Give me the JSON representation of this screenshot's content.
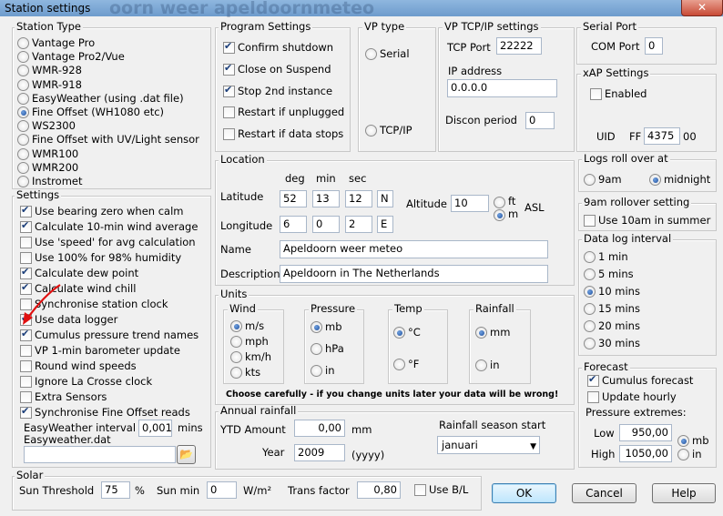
{
  "window": {
    "title": "Station settings",
    "ghost_text": "oorn weer apeldoornmeteo"
  },
  "station_type": {
    "title": "Station Type",
    "options": [
      "Vantage Pro",
      "Vantage Pro2/Vue",
      "WMR-928",
      "WMR-918",
      "EasyWeather (using .dat file)",
      "Fine Offset (WH1080 etc)",
      "WS2300",
      "Fine Offset with UV/Light sensor",
      "WMR100",
      "WMR200",
      "Instromet"
    ],
    "selected": "Fine Offset (WH1080 etc)"
  },
  "settings": {
    "title": "Settings",
    "items": [
      {
        "label": "Use bearing zero when calm",
        "checked": true
      },
      {
        "label": "Calculate 10-min wind average",
        "checked": true
      },
      {
        "label": "Use 'speed' for avg calculation",
        "checked": false
      },
      {
        "label": "Use 100% for 98% humidity",
        "checked": false
      },
      {
        "label": "Calculate dew point",
        "checked": true
      },
      {
        "label": "Calculate wind chill",
        "checked": true
      },
      {
        "label": "Synchronise station clock",
        "checked": false
      },
      {
        "label": "Use data logger",
        "checked": true
      },
      {
        "label": "Cumulus pressure trend names",
        "checked": true
      },
      {
        "label": "VP 1-min barometer update",
        "checked": false
      },
      {
        "label": "Round wind speeds",
        "checked": false
      },
      {
        "label": "Ignore La Crosse clock",
        "checked": false
      },
      {
        "label": "Extra Sensors",
        "checked": false
      },
      {
        "label": "Synchronise Fine Offset reads",
        "checked": true
      }
    ],
    "easyweather_interval_label": "EasyWeather interval",
    "easyweather_interval_value": "0,001",
    "easyweather_interval_unit": "mins",
    "easyweather_file_label": "Easyweather.dat",
    "easyweather_file_value": ""
  },
  "program": {
    "title": "Program Settings",
    "items": [
      {
        "label": "Confirm shutdown",
        "checked": true
      },
      {
        "label": "Close on Suspend",
        "checked": true
      },
      {
        "label": "Stop 2nd instance",
        "checked": true
      },
      {
        "label": "Restart if unplugged",
        "checked": false
      },
      {
        "label": "Restart if data stops",
        "checked": false
      }
    ]
  },
  "vp_type": {
    "title": "VP type",
    "serial": "Serial",
    "tcpip": "TCP/IP"
  },
  "vp_tcpip": {
    "title": "VP TCP/IP settings",
    "tcp_port_label": "TCP Port",
    "tcp_port": "22222",
    "ip_label": "IP address",
    "ip": "0.0.0.0",
    "discon_label": "Discon period",
    "discon": "0"
  },
  "serial_port": {
    "title": "Serial Port",
    "com_label": "COM Port",
    "com": "0"
  },
  "xap": {
    "title": "xAP Settings",
    "enabled_label": "Enabled",
    "enabled": false,
    "uid_label": "UID",
    "uid_prefix": "FF",
    "uid_value": "4375",
    "uid_suffix": "00"
  },
  "location": {
    "title": "Location",
    "deg": "deg",
    "min": "min",
    "sec": "sec",
    "lat_label": "Latitude",
    "lat_deg": "52",
    "lat_min": "13",
    "lat_sec": "12",
    "lat_hem": "N",
    "lon_label": "Longitude",
    "lon_deg": "6",
    "lon_min": "0",
    "lon_sec": "2",
    "lon_hem": "E",
    "alt_label": "Altitude",
    "alt_value": "10",
    "alt_ft": "ft",
    "alt_m": "m",
    "asl": "ASL",
    "name_label": "Name",
    "name": "Apeldoorn weer meteo",
    "desc_label": "Description",
    "desc": "Apeldoorn in The Netherlands"
  },
  "units": {
    "title": "Units",
    "wind": {
      "title": "Wind",
      "options": [
        "m/s",
        "mph",
        "km/h",
        "kts"
      ],
      "selected": "m/s"
    },
    "pressure": {
      "title": "Pressure",
      "options": [
        "mb",
        "hPa",
        "in"
      ],
      "selected": "mb"
    },
    "temp": {
      "title": "Temp",
      "options": [
        "°C",
        "°F"
      ],
      "selected": "°C"
    },
    "rainfall": {
      "title": "Rainfall",
      "options": [
        "mm",
        "in"
      ],
      "selected": "mm"
    },
    "warning": "Choose carefully - if you change units later your data will be wrong!"
  },
  "annual": {
    "title": "Annual rainfall",
    "ytd_label": "YTD Amount",
    "ytd": "0,00",
    "ytd_unit": "mm",
    "year_label": "Year",
    "year": "2009",
    "year_unit": "(yyyy)",
    "season_label": "Rainfall season start",
    "season": "januari"
  },
  "logs_roll": {
    "title": "Logs roll over at",
    "opt1": "9am",
    "opt2": "midnight",
    "selected": "midnight"
  },
  "rollover": {
    "title": "9am rollover setting",
    "label": "Use 10am in summer",
    "checked": false
  },
  "data_log": {
    "title": "Data log interval",
    "options": [
      "1 min",
      "5 mins",
      "10 mins",
      "15 mins",
      "20 mins",
      "30 mins"
    ],
    "selected": "10 mins"
  },
  "forecast": {
    "title": "Forecast",
    "cumulus_label": "Cumulus forecast",
    "cumulus": true,
    "hourly_label": "Update hourly",
    "hourly": false,
    "extremes_label": "Pressure extremes:",
    "low_label": "Low",
    "low": "950,00",
    "high_label": "High",
    "high": "1050,00",
    "unit_mb": "mb",
    "unit_in": "in",
    "unit_selected": "mb"
  },
  "solar": {
    "title": "Solar",
    "threshold_label": "Sun Threshold",
    "threshold": "75",
    "threshold_unit": "%",
    "sunmin_label": "Sun min",
    "sunmin": "0",
    "sunmin_unit": "W/m²",
    "trans_label": "Trans factor",
    "trans": "0,80",
    "usebl_label": "Use B/L",
    "usebl": false
  },
  "buttons": {
    "ok": "OK",
    "cancel": "Cancel",
    "help": "Help"
  },
  "colors": {
    "arrow": "#e01010",
    "titlebar": "#7aa6d6",
    "default_button": "#3c7fb1"
  }
}
